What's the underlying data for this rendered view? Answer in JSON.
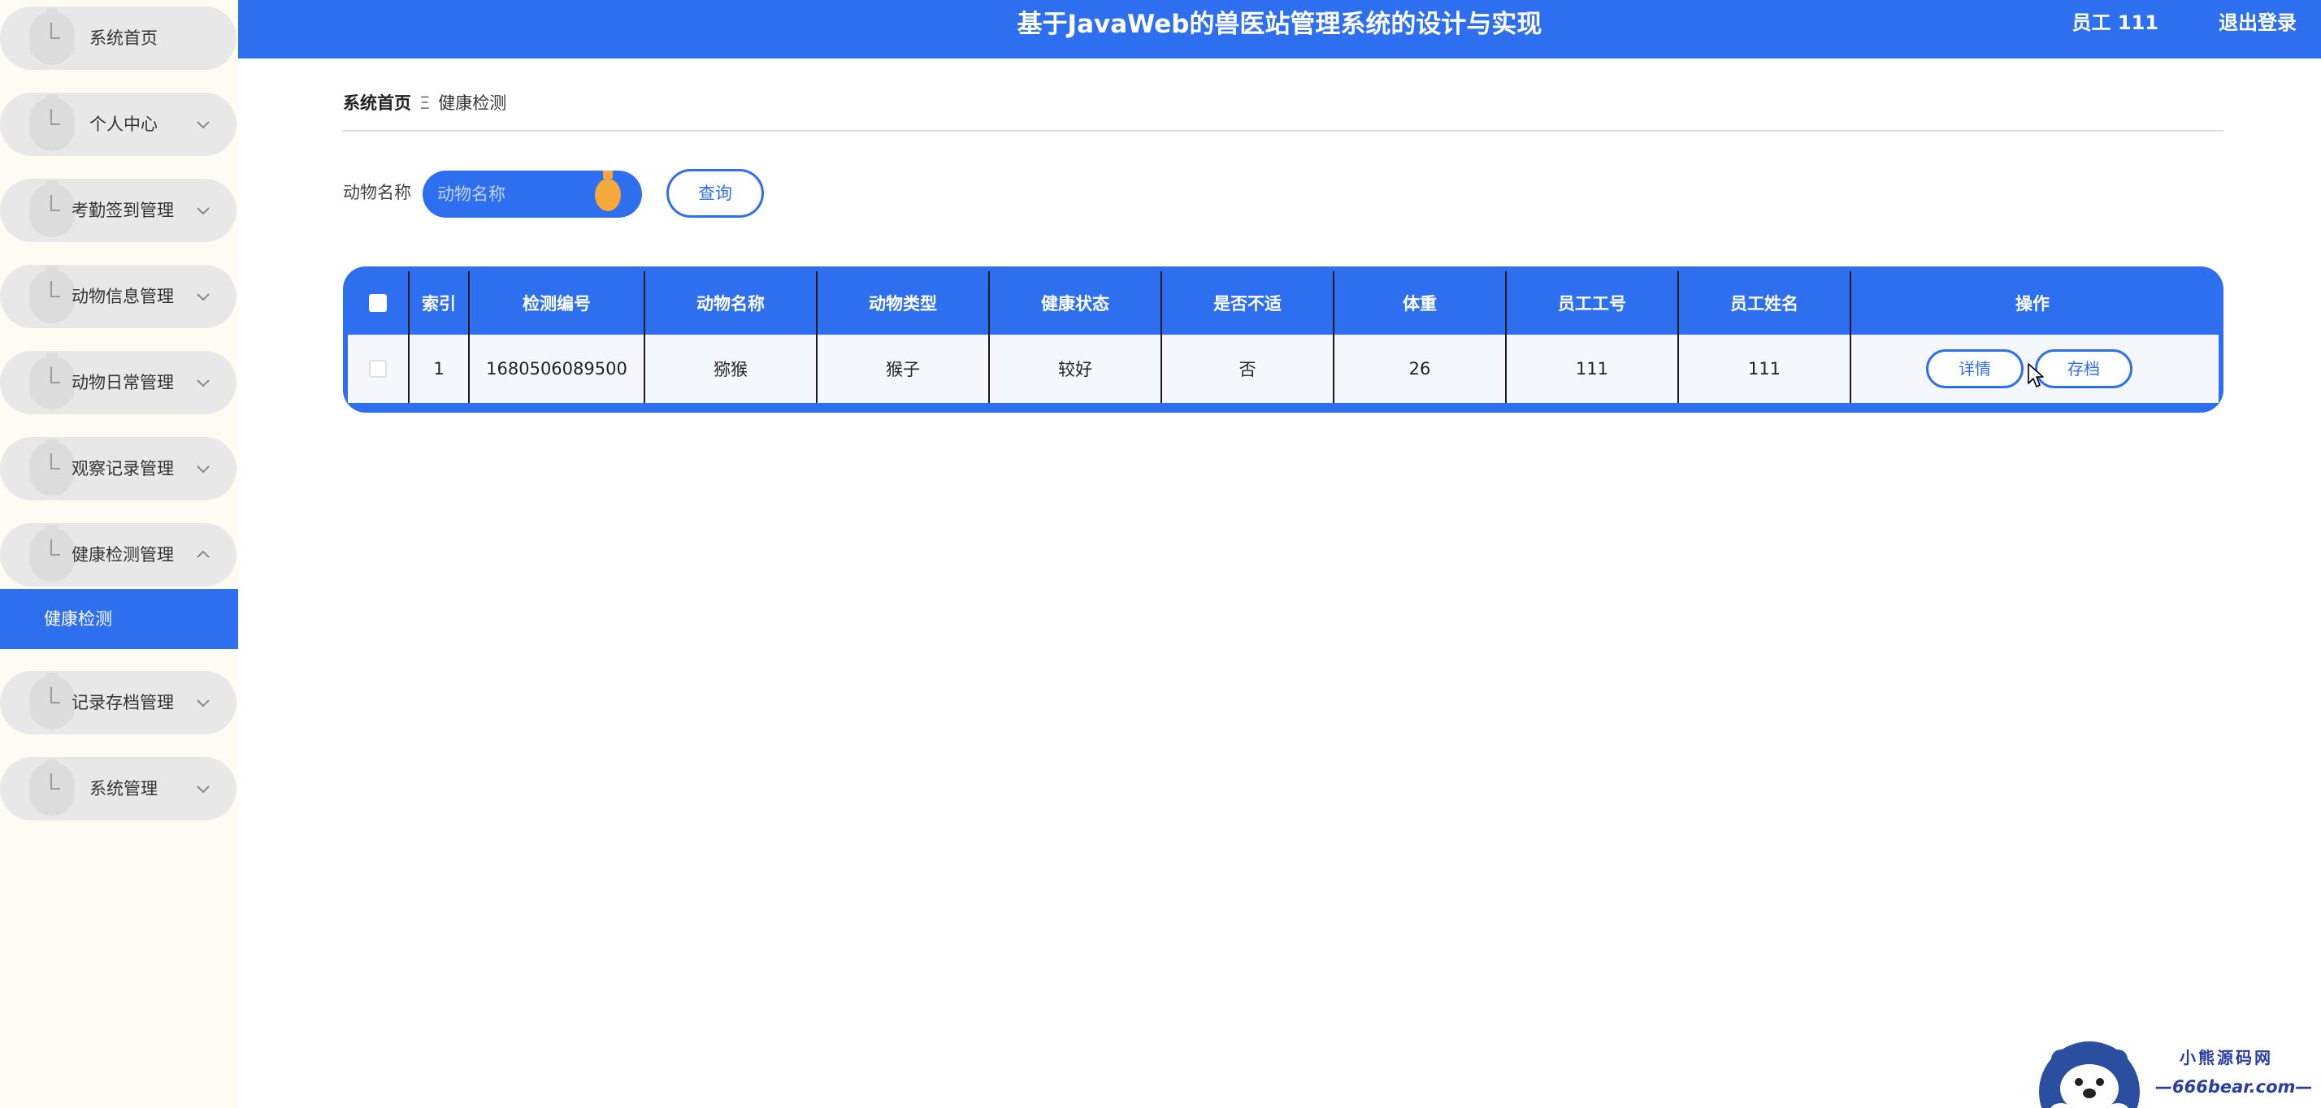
{
  "header": {
    "title": "基于JavaWeb的兽医站管理系统的设计与实现",
    "user": "员工 111",
    "logout": "退出登录"
  },
  "sidebar": {
    "items": [
      {
        "label": "系统首页",
        "has_chevron": false
      },
      {
        "label": "个人中心",
        "has_chevron": true
      },
      {
        "label": "考勤签到管理",
        "has_chevron": true
      },
      {
        "label": "动物信息管理",
        "has_chevron": true
      },
      {
        "label": "动物日常管理",
        "has_chevron": true
      },
      {
        "label": "观察记录管理",
        "has_chevron": true
      },
      {
        "label": "健康检测管理",
        "has_chevron": true,
        "expanded": true
      },
      {
        "label": "记录存档管理",
        "has_chevron": true
      },
      {
        "label": "系统管理",
        "has_chevron": true
      }
    ],
    "active_sub": "健康检测"
  },
  "breadcrumb": {
    "home": "系统首页",
    "separator": "Ξ",
    "current": "健康检测"
  },
  "search": {
    "label": "动物名称",
    "placeholder": "动物名称",
    "button": "查询"
  },
  "table": {
    "columns": [
      "索引",
      "检测编号",
      "动物名称",
      "动物类型",
      "健康状态",
      "是否不适",
      "体重",
      "员工工号",
      "员工姓名",
      "操作"
    ],
    "rows": [
      {
        "index": "1",
        "code": "1680506089500",
        "name": "猕猴",
        "type": "猴子",
        "health": "较好",
        "discomfort": "否",
        "weight": "26",
        "staff_no": "111",
        "staff_name": "111",
        "actions": [
          "详情",
          "存档"
        ]
      }
    ]
  },
  "watermark": {
    "top": "小熊源码网",
    "bottom": "—666bear.com—"
  },
  "colors": {
    "primary": "#2e6ff0",
    "sidebar_bg": "#fdfbf2",
    "menu_item_bg": "#e8e8e8",
    "row_bg": "#f4f8fd",
    "accent_orange": "#f4a93a"
  }
}
